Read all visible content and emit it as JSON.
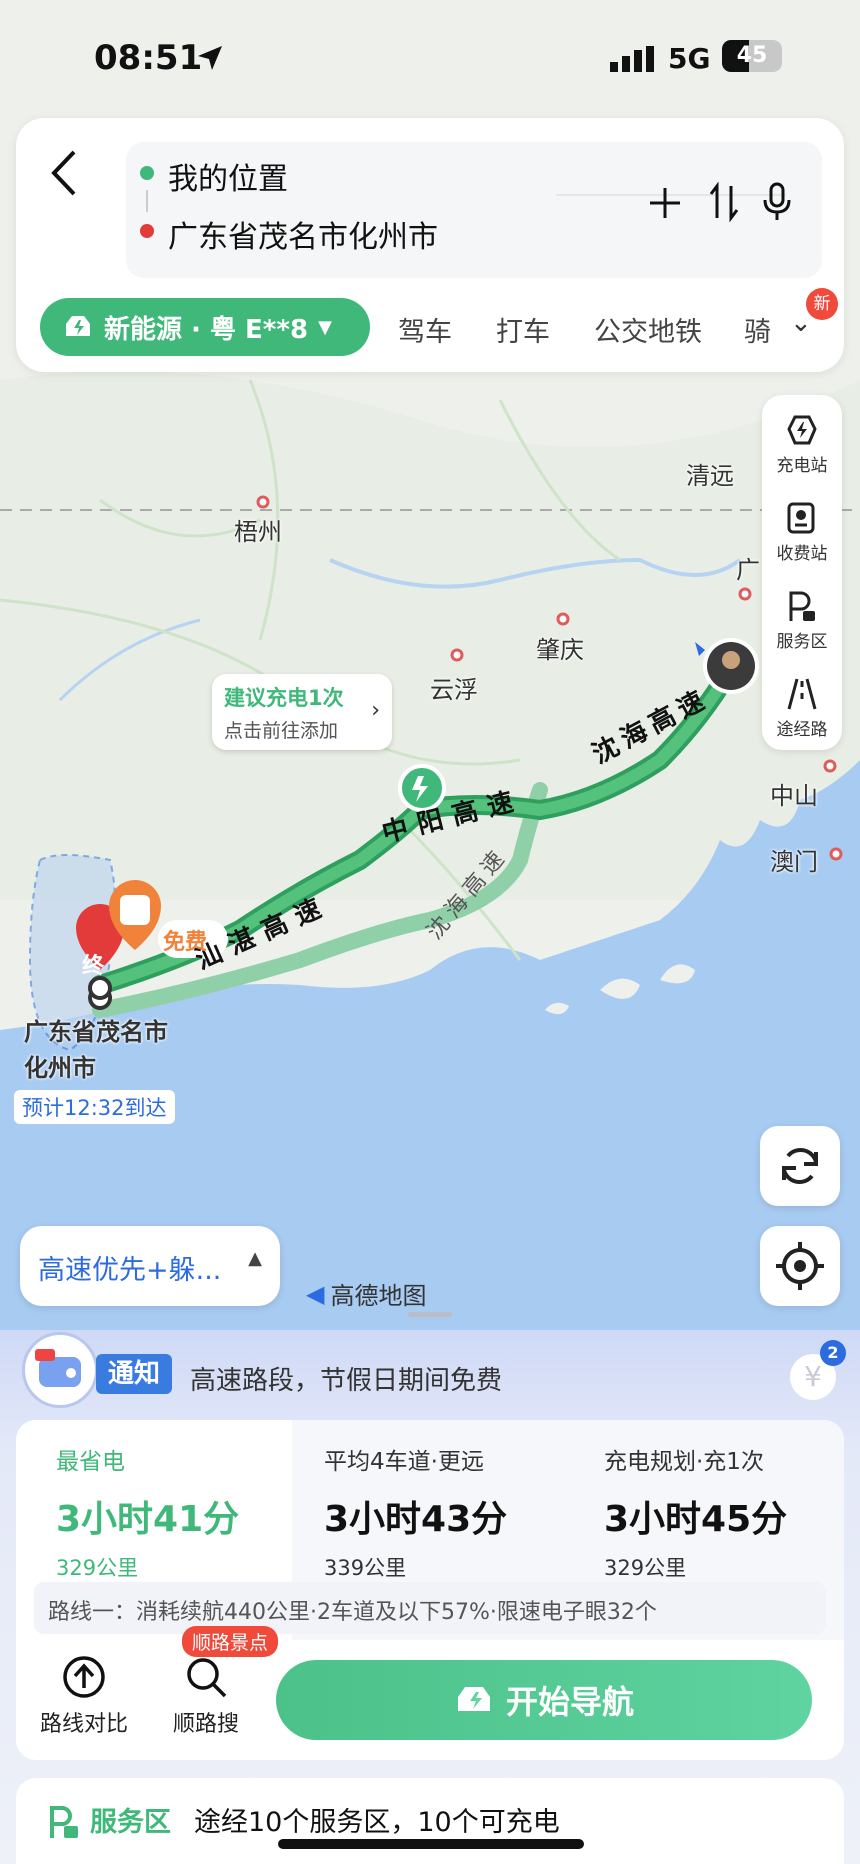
{
  "status_bar": {
    "time": "08:51",
    "network": "5G",
    "battery_level": 45,
    "battery_text": "45"
  },
  "route_inputs": {
    "origin": "我的位置",
    "destination": "广东省茂名市化州市"
  },
  "vehicle_pill": {
    "label": "新能源 · 粤 E**8"
  },
  "transport_modes": [
    "驾车",
    "打车",
    "公交地铁",
    "骑"
  ],
  "new_badge": "新",
  "toolbar": [
    {
      "label": "充电站",
      "icon": "charging-station-icon"
    },
    {
      "label": "收费站",
      "icon": "toll-station-icon"
    },
    {
      "label": "服务区",
      "icon": "service-area-icon"
    },
    {
      "label": "途经路",
      "icon": "via-road-icon"
    }
  ],
  "map": {
    "cities": [
      "清远",
      "梧州",
      "广",
      "肇庆",
      "云浮",
      "中山",
      "澳门"
    ],
    "highways": [
      "沈海高速",
      "中阳高速",
      "汕湛高速",
      "沈海高速"
    ],
    "destination_label_line1": "广东省茂名市",
    "destination_label_line2": "化州市",
    "end_marker": "终",
    "free_tag": "免费",
    "eta": "预计12:32到达",
    "charge_suggestion": {
      "title": "建议充电1次",
      "subtitle": "点击前往添加"
    },
    "preference": "高速优先+躲...",
    "logo": "高德地图"
  },
  "notice": {
    "tag": "通知",
    "text": "高速路段，节假日期间免费",
    "coupon_count": "2"
  },
  "routes": [
    {
      "label": "最省电",
      "time": "3小时41分",
      "distance": "329公里",
      "selected": true
    },
    {
      "label": "平均4车道·更远",
      "time": "3小时43分",
      "distance": "339公里",
      "selected": false
    },
    {
      "label": "充电规划·充1次",
      "time": "3小时45分",
      "distance": "329公里",
      "selected": false
    }
  ],
  "route_info": "路线一：消耗续航440公里·2车道及以下57%·限速电子眼32个",
  "actions": {
    "compare": "路线对比",
    "along_search": "顺路搜",
    "along_badge": "顺路景点",
    "start": "开始导航"
  },
  "service_area": {
    "title": "服务区",
    "text": "途经10个服务区，10个可充电"
  },
  "colors": {
    "accent_green": "#3fb87a",
    "route_green": "#2f9f5d",
    "alt_route": "#7fc79c",
    "sea": "#a8cbf2",
    "notice_blue": "#3a7be0",
    "badge_red": "#f04a3b"
  }
}
